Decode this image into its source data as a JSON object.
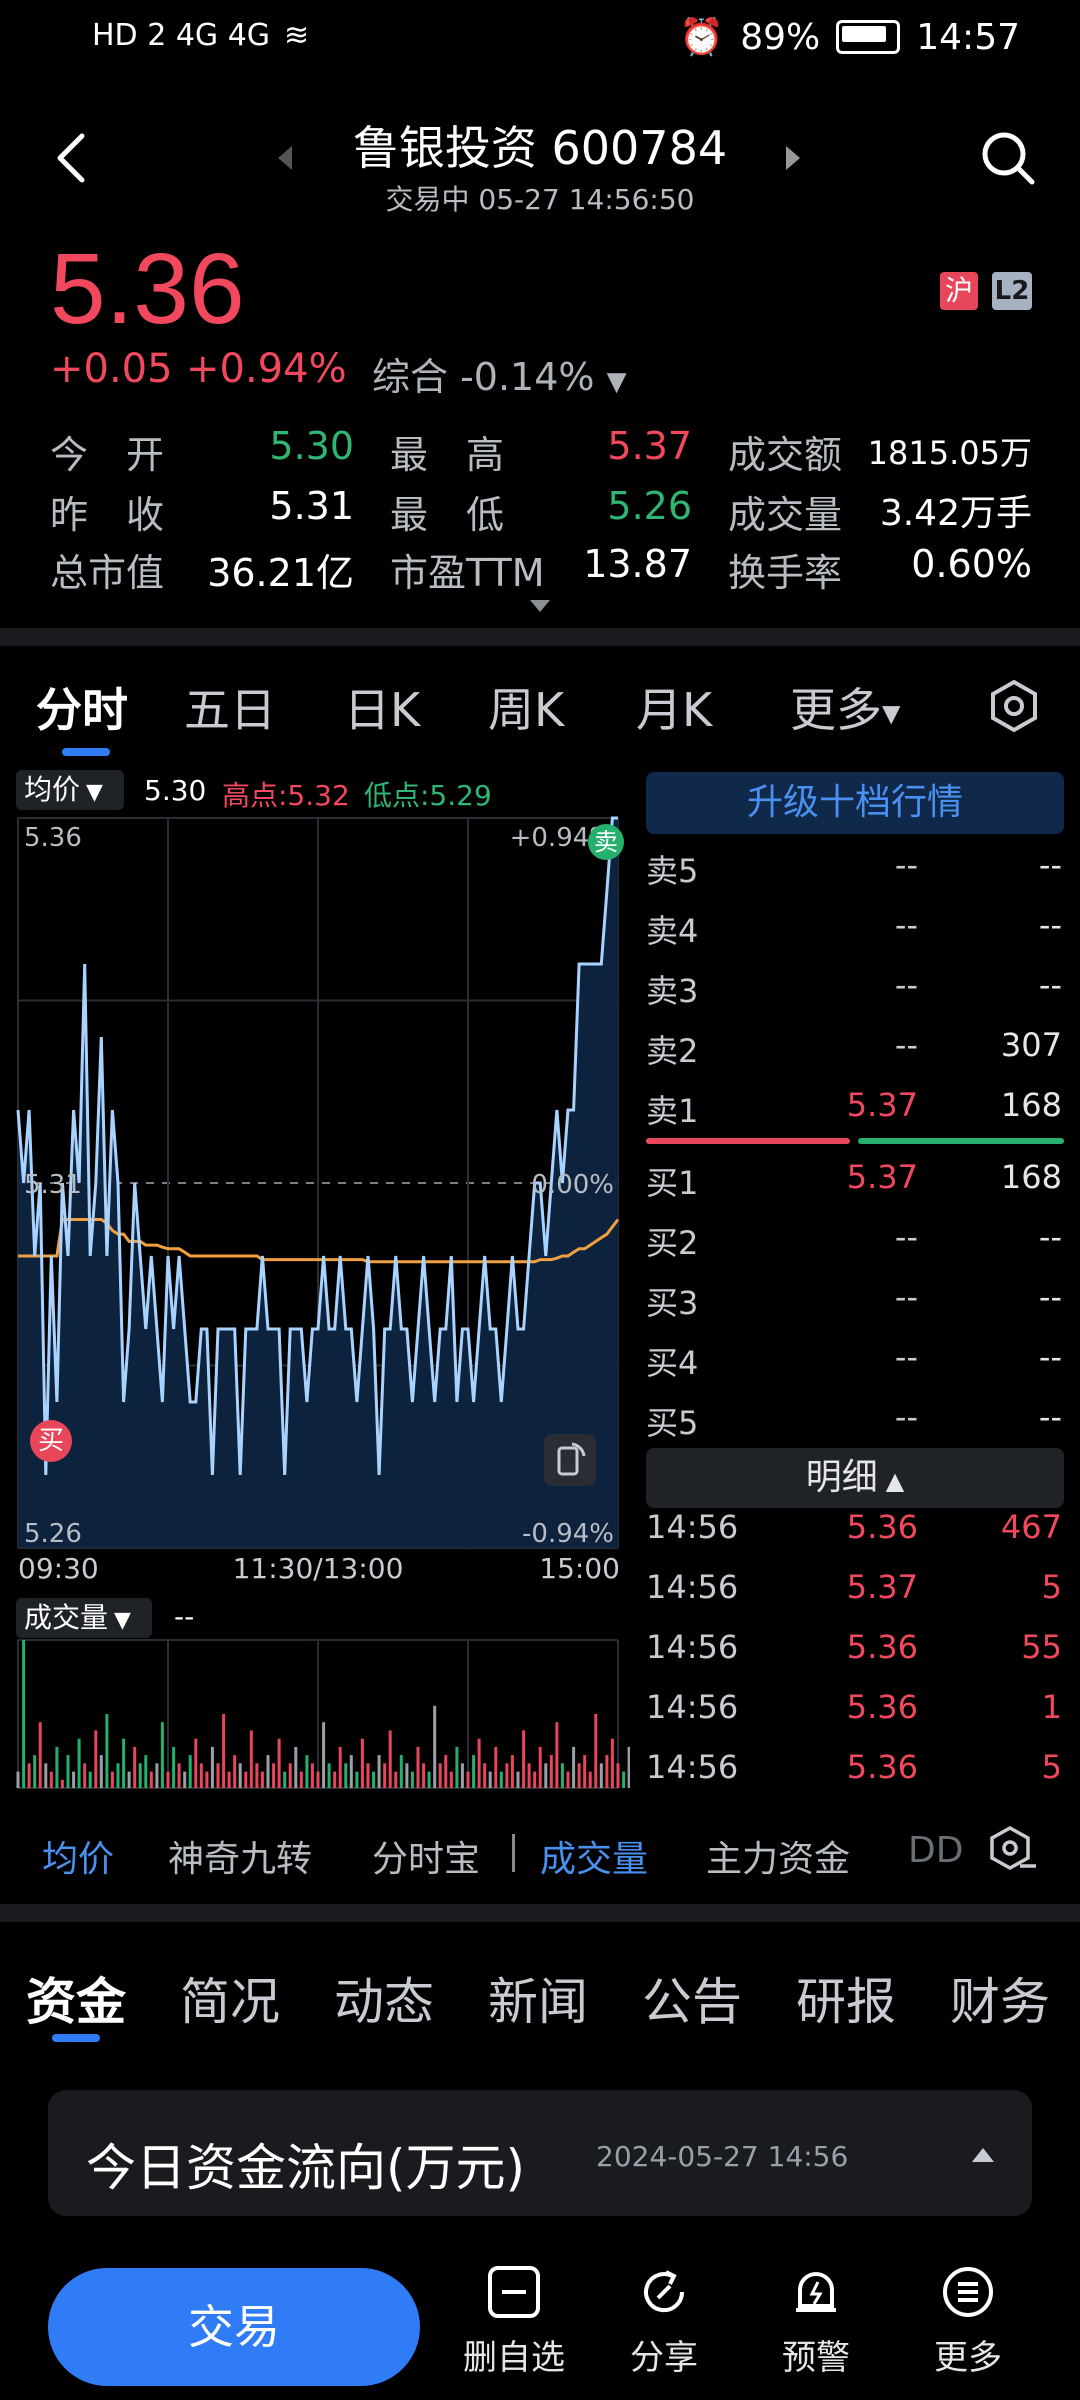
{
  "status_bar": {
    "left": "HD 2 4G 4G",
    "battery": "89%",
    "time": "14:57"
  },
  "header": {
    "title": "鲁银投资 600784",
    "subtitle": "交易中 05-27 14:56:50"
  },
  "quote": {
    "price": "5.36",
    "change": "+0.05",
    "change_pct": "+0.94%",
    "composite": "综合 -0.14%",
    "tag_exchange": "沪",
    "tag_level": "L2"
  },
  "stats": [
    {
      "label": "今　开",
      "value": "5.30",
      "color": "green"
    },
    {
      "label": "最　高",
      "value": "5.37",
      "color": "red"
    },
    {
      "label": "成交额",
      "value": "1815.05万",
      "color": "white"
    },
    {
      "label": "昨　收",
      "value": "5.31",
      "color": "white"
    },
    {
      "label": "最　低",
      "value": "5.26",
      "color": "green"
    },
    {
      "label": "成交量",
      "value": "3.42万手",
      "color": "white"
    },
    {
      "label": "总市值",
      "value": "36.21亿",
      "color": "white"
    },
    {
      "label": "市盈TTM",
      "value": "13.87",
      "color": "white"
    },
    {
      "label": "换手率",
      "value": "0.60%",
      "color": "white"
    }
  ],
  "chart_tabs": [
    "分时",
    "五日",
    "日K",
    "周K",
    "月K",
    "更多"
  ],
  "chart_legend": {
    "avg_btn": "均价",
    "avg": "5.30",
    "high": "高点:5.32",
    "low": "低点:5.29"
  },
  "chart_data": {
    "type": "line",
    "y_left_ticks": [
      "5.36",
      "5.31",
      "5.26"
    ],
    "y_right_ticks": [
      "+0.94%",
      "0.00%",
      "-0.94%"
    ],
    "x_ticks": [
      "09:30",
      "11:30/13:00",
      "15:00"
    ],
    "ylim": [
      5.26,
      5.36
    ],
    "prev_close": 5.31,
    "markers": [
      {
        "label": "卖",
        "side": "sell"
      },
      {
        "label": "买",
        "side": "buy"
      }
    ],
    "series": [
      {
        "name": "price",
        "values": [
          5.32,
          5.31,
          5.32,
          5.3,
          5.31,
          5.27,
          5.3,
          5.28,
          5.31,
          5.3,
          5.32,
          5.31,
          5.34,
          5.3,
          5.31,
          5.33,
          5.3,
          5.32,
          5.31,
          5.28,
          5.29,
          5.31,
          5.3,
          5.29,
          5.3,
          5.29,
          5.28,
          5.3,
          5.29,
          5.3,
          5.29,
          5.28,
          5.28,
          5.29,
          5.29,
          5.27,
          5.29,
          5.29,
          5.29,
          5.29,
          5.27,
          5.29,
          5.29,
          5.29,
          5.3,
          5.29,
          5.29,
          5.29,
          5.27,
          5.29,
          5.29,
          5.29,
          5.28,
          5.29,
          5.29,
          5.3,
          5.29,
          5.29,
          5.3,
          5.29,
          5.29,
          5.28,
          5.29,
          5.3,
          5.29,
          5.27,
          5.29,
          5.29,
          5.3,
          5.29,
          5.29,
          5.28,
          5.29,
          5.3,
          5.29,
          5.28,
          5.29,
          5.29,
          5.3,
          5.28,
          5.29,
          5.29,
          5.28,
          5.29,
          5.3,
          5.29,
          5.29,
          5.28,
          5.29,
          5.3,
          5.29,
          5.29,
          5.3,
          5.31,
          5.31,
          5.3,
          5.31,
          5.32,
          5.31,
          5.32,
          5.32,
          5.34,
          5.34,
          5.34,
          5.34,
          5.34,
          5.35,
          5.36,
          5.36
        ]
      },
      {
        "name": "avg",
        "values": [
          5.3,
          5.3,
          5.3,
          5.3,
          5.3,
          5.3,
          5.3,
          5.3,
          5.305,
          5.305,
          5.305,
          5.305,
          5.305,
          5.305,
          5.305,
          5.305,
          5.3045,
          5.3035,
          5.303,
          5.303,
          5.302,
          5.302,
          5.302,
          5.3015,
          5.3015,
          5.3015,
          5.3012,
          5.301,
          5.301,
          5.301,
          5.3005,
          5.3,
          5.3,
          5.3,
          5.3,
          5.3,
          5.3,
          5.3,
          5.3,
          5.3,
          5.3,
          5.3,
          5.3,
          5.3,
          5.2995,
          5.2995,
          5.2995,
          5.2995,
          5.2995,
          5.2995,
          5.2995,
          5.2995,
          5.2995,
          5.2995,
          5.2995,
          5.2995,
          5.2995,
          5.2995,
          5.2995,
          5.2995,
          5.2995,
          5.2995,
          5.2995,
          5.2992,
          5.2992,
          5.2992,
          5.2992,
          5.2992,
          5.2992,
          5.2992,
          5.2992,
          5.2992,
          5.2992,
          5.2992,
          5.2992,
          5.2992,
          5.2992,
          5.2992,
          5.2992,
          5.2992,
          5.2992,
          5.2992,
          5.2992,
          5.2992,
          5.2992,
          5.2992,
          5.2992,
          5.2992,
          5.2992,
          5.2992,
          5.2992,
          5.2992,
          5.2992,
          5.2992,
          5.2995,
          5.2995,
          5.2995,
          5.2997,
          5.3,
          5.3,
          5.3005,
          5.301,
          5.301,
          5.3015,
          5.302,
          5.3025,
          5.303,
          5.304,
          5.305
        ]
      },
      {
        "name": "volume",
        "values": [
          2,
          18,
          3,
          4,
          8,
          3,
          2,
          5,
          1,
          4,
          2,
          6,
          3,
          2,
          7,
          4,
          9,
          2,
          3,
          6,
          2,
          5,
          3,
          4,
          2,
          3,
          8,
          2,
          5,
          3,
          2,
          4,
          6,
          3,
          2,
          5,
          3,
          9,
          2,
          4,
          3,
          2,
          7,
          3,
          2,
          4,
          3,
          6,
          2,
          3,
          5,
          2,
          4,
          3,
          2,
          8,
          3,
          2,
          5,
          3,
          4,
          2,
          6,
          3,
          2,
          4,
          3,
          7,
          2,
          4,
          3,
          2,
          5,
          3,
          2,
          10,
          3,
          4,
          2,
          5,
          3,
          2,
          4,
          6,
          3,
          2,
          5,
          2,
          3,
          4,
          2,
          7,
          3,
          2,
          5,
          3,
          4,
          8,
          3,
          2,
          5,
          3,
          4,
          2,
          9,
          3,
          4,
          6,
          3,
          2,
          5
        ]
      }
    ]
  },
  "volume_legend": {
    "btn": "成交量",
    "value": "--"
  },
  "orderbook": {
    "upgrade": "升级十档行情",
    "sells": [
      {
        "label": "卖5",
        "price": "--",
        "vol": "--"
      },
      {
        "label": "卖4",
        "price": "--",
        "vol": "--"
      },
      {
        "label": "卖3",
        "price": "--",
        "vol": "--"
      },
      {
        "label": "卖2",
        "price": "--",
        "vol": "307"
      },
      {
        "label": "卖1",
        "price": "5.37",
        "vol": "168"
      }
    ],
    "buys": [
      {
        "label": "买1",
        "price": "5.37",
        "vol": "168"
      },
      {
        "label": "买2",
        "price": "--",
        "vol": "--"
      },
      {
        "label": "买3",
        "price": "--",
        "vol": "--"
      },
      {
        "label": "买4",
        "price": "--",
        "vol": "--"
      },
      {
        "label": "买5",
        "price": "--",
        "vol": "--"
      }
    ],
    "detail_btn": "明细",
    "details": [
      {
        "time": "14:56",
        "price": "5.36",
        "vol": "467"
      },
      {
        "time": "14:56",
        "price": "5.37",
        "vol": "5"
      },
      {
        "time": "14:56",
        "price": "5.36",
        "vol": "55"
      },
      {
        "time": "14:56",
        "price": "5.36",
        "vol": "1"
      },
      {
        "time": "14:56",
        "price": "5.36",
        "vol": "5"
      }
    ]
  },
  "indicators": [
    "均价",
    "神奇九转",
    "分时宝",
    "成交量",
    "主力资金",
    "DD"
  ],
  "bottom_tabs": [
    "资金",
    "简况",
    "动态",
    "新闻",
    "公告",
    "研报",
    "财务"
  ],
  "fund_card": {
    "title": "今日资金流向(万元)",
    "date": "2024-05-27 14:56"
  },
  "bottom_bar": {
    "trade": "交易",
    "items": [
      "删自选",
      "分享",
      "预警",
      "更多"
    ]
  },
  "colors": {
    "red": "#f2485e",
    "green": "#2fb574",
    "accent": "#2f7cf6",
    "price_line": "#a9d3ff",
    "avg_line": "#f0a040"
  }
}
